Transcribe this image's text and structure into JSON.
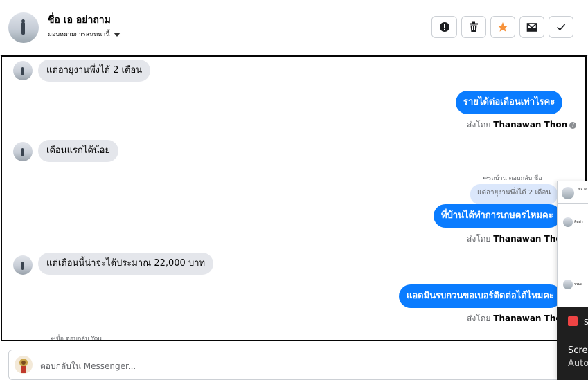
{
  "header": {
    "contact_name": "ชื่อ เอ อย่าถาม",
    "assign_label": "มอบหมายการสนทนานี้",
    "actions": [
      {
        "name": "report-icon",
        "label": "!"
      },
      {
        "name": "trash-icon",
        "label": ""
      },
      {
        "name": "star-icon",
        "label": "★"
      },
      {
        "name": "mark-unread-icon",
        "label": ""
      },
      {
        "name": "check-icon",
        "label": "✓"
      }
    ]
  },
  "messages": {
    "in_1": "แต่อายุงานพึ่งได้ 2 เดือน",
    "out_1": "รายได้ต่อเดือนเท่าไรคะ",
    "sent_prefix": "ส่งโดย",
    "sender": "Thanawan Thon",
    "in_2": "เดือนแรกได้น้อย",
    "reply_note_out": "↩รถบ้าน ตอบกลับ ชื่อ",
    "quoted_text": "แต่อายุงานพึ่งได้ 2 เดือน",
    "out_2": "ที่บ้านได้ทำการเกษตรไหมคะ",
    "in_3": "แต่เดือนนี้น่าจะได้ประมาณ 22,000 บาท",
    "out_3": "แอดมินรบกวนขอเบอร์ติดต่อได้ไหมคะ",
    "reply_note_in": "↩ชื่อ ตอบกลับ You"
  },
  "composer": {
    "placeholder": "ตอบกลับใน Messenger..."
  },
  "popup": {
    "row1": "ชื่อ เอ",
    "row2": "คิดค่า",
    "row3": "รวมแ"
  },
  "toast": {
    "title": "S",
    "line1": "Scree",
    "line2": "Auto"
  },
  "colors": {
    "accent": "#0a7cff",
    "star": "#f7923a",
    "incoming_bubble": "#e4e6eb"
  }
}
